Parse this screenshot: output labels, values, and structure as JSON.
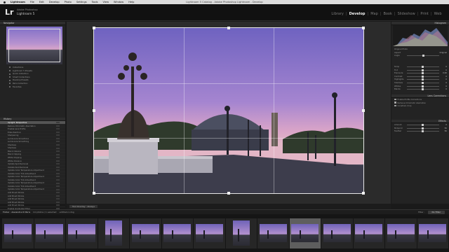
{
  "menubar": {
    "items": [
      "Lightroom",
      "File",
      "Edit",
      "Develop",
      "Photo",
      "Settings",
      "Tools",
      "View",
      "Window",
      "Help"
    ],
    "window_title": "Lightroom 5 Catalog - Adobe Photoshop Lightroom - Develop"
  },
  "identity": {
    "logo": "Lr",
    "brand_line1": "Adobe Photoshop",
    "brand_line2": "Lightroom 5",
    "modules": [
      "Library",
      "Develop",
      "Map",
      "Book",
      "Slideshow",
      "Print",
      "Web"
    ],
    "active_module": "Develop"
  },
  "left_panel": {
    "navigator_title": "Navigator",
    "collections": [
      "Collections",
      "Lightroom 5 Presets",
      "Quick Collection",
      "Smart Collections",
      "Develop Presets",
      "Paris Collection",
      "Favorites"
    ],
    "presets_title": "History",
    "presets": [
      "Upright: Perspective",
      "Reduce Chromatic Aberration",
      "Enable Lens Profile",
      "Edge Painting",
      "Sharpening",
      "Luminance Smoothing",
      "Luminance Smoothing",
      "Shadows",
      "Shadows",
      "Black Clipping",
      "Black Clipping",
      "White Clipping",
      "White Clipping",
      "Update Spot Removal",
      "Update Spot Removal",
      "Update Color Temperature Adjustment",
      "Update Color Tint Adjustment",
      "Update Color Temperature Adjustment",
      "Update Color Tint Adjustment",
      "Update Color Temperature Adjustment",
      "Update Color Tint Adjustment",
      "Update Color Temperature Adjustment",
      "Add Brush Stroke",
      "Add Brush Stroke",
      "Add Brush Stroke",
      "Add Brush Stroke",
      "Add Brush Stroke",
      "Enable Graduated Filter",
      "Enable Graduated Filter",
      "Import"
    ],
    "selected_preset_index": 0,
    "copy_label": "Copy...",
    "paste_label": "Paste"
  },
  "toolbar": {
    "tool_overlay": "Tool Overlay : Always"
  },
  "right_panel": {
    "histogram_title": "Histogram",
    "original_photo_label": "Original Photo",
    "aspect_label": "Aspect",
    "aspect_value": "Original",
    "angle_label": "Angle",
    "rows": [
      {
        "label": "Temp",
        "value": "0",
        "knob": 0.5
      },
      {
        "label": "Tint",
        "value": "0",
        "knob": 0.5
      },
      {
        "label": "Exposure",
        "value": "0.00",
        "knob": 0.5
      },
      {
        "label": "Contrast",
        "value": "0",
        "knob": 0.5
      },
      {
        "label": "Highlights",
        "value": "0",
        "knob": 0.5
      },
      {
        "label": "Shadows",
        "value": "0",
        "knob": 0.5
      },
      {
        "label": "Whites",
        "value": "0",
        "knob": 0.5
      },
      {
        "label": "Blacks",
        "value": "0",
        "knob": 0.5
      }
    ],
    "lens_title": "Lens Corrections",
    "lens_options": [
      "Enable Profile Corrections",
      "Remove Chromatic Aberration",
      "Constrain Crop"
    ],
    "effects_title": "Effects",
    "effects_rows": [
      {
        "label": "Amount",
        "value": "0",
        "knob": 0.5
      },
      {
        "label": "Midpoint",
        "value": "50",
        "knob": 0.5
      },
      {
        "label": "Feather",
        "value": "50",
        "knob": 0.5
      }
    ],
    "previous_label": "Previous",
    "reset_label": "Reset"
  },
  "filmstrip": {
    "source": "Folder : Alexandre III Paris",
    "count_text": "14 photos / 1 selected",
    "file_name": "untitled-1.dng",
    "filter_label": "Filter :",
    "filter_value": "No Filter",
    "thumb_count": 14,
    "selected_index": 9,
    "tall_indices": [
      3,
      7
    ]
  }
}
